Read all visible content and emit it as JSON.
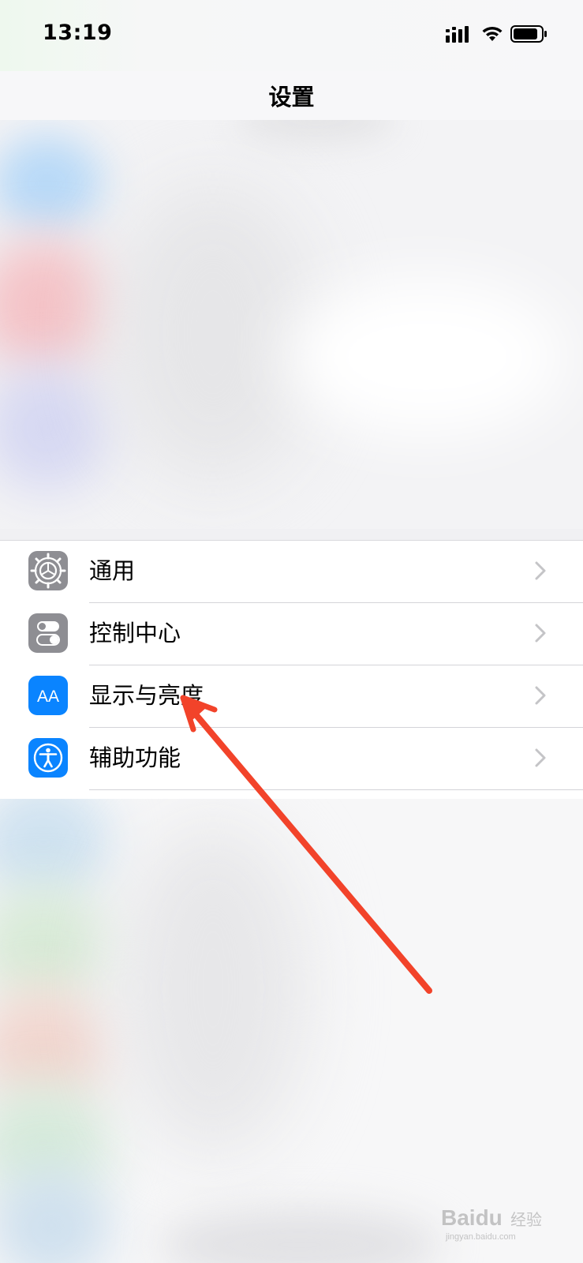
{
  "status_bar": {
    "time": "13:19",
    "icons": [
      "cellular-signal-icon",
      "wifi-icon",
      "battery-icon"
    ]
  },
  "nav": {
    "title": "设置"
  },
  "settings": {
    "items": [
      {
        "label": "通用",
        "icon": "gear-icon",
        "icon_color": "#8e8e93"
      },
      {
        "label": "控制中心",
        "icon": "toggles-icon",
        "icon_color": "#8e8e93"
      },
      {
        "label": "显示与亮度",
        "icon": "text-size-icon",
        "icon_color": "#0a84ff",
        "icon_text": "AA"
      },
      {
        "label": "辅助功能",
        "icon": "accessibility-icon",
        "icon_color": "#0a84ff"
      }
    ]
  },
  "annotation": {
    "color": "#f2432a",
    "target": "显示与亮度"
  },
  "watermark": {
    "brand": "Baidu",
    "suffix": "经验",
    "url": "jingyan.baidu.com"
  }
}
